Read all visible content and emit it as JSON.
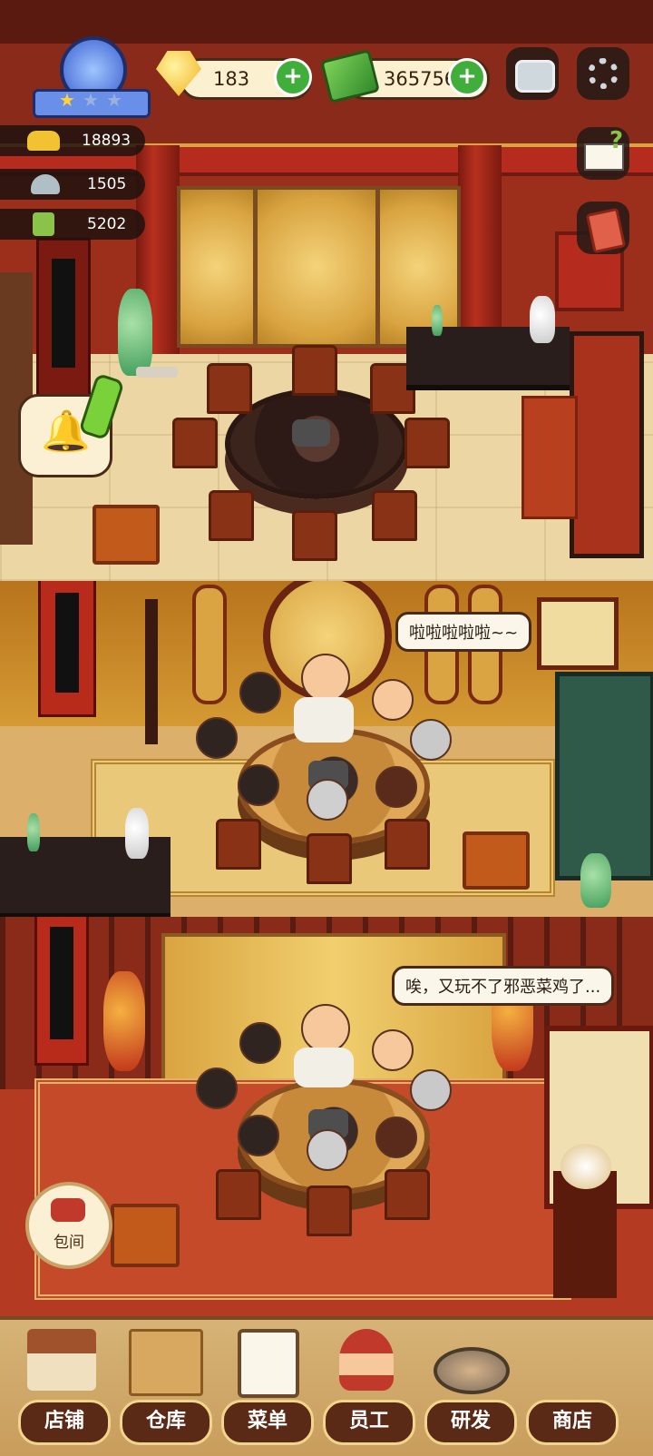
{
  "hud": {
    "gems": "183",
    "cash": "365756",
    "stat_gold_ingot": "18893",
    "stat_dish": "1505",
    "stat_ticket": "5202",
    "level_stars": 1
  },
  "bubbles": {
    "floor2": "啦啦啦啦啦~~",
    "floor3": "唉，又玩不了邪恶菜鸡了..."
  },
  "side_buttons": {
    "private_room": "包间"
  },
  "nav": [
    {
      "label": "店铺",
      "icon": "storefront-icon"
    },
    {
      "label": "仓库",
      "icon": "boxes-icon"
    },
    {
      "label": "菜单",
      "icon": "clipboard-icon"
    },
    {
      "label": "员工",
      "icon": "waitress-icon"
    },
    {
      "label": "研发",
      "icon": "wok-icon"
    },
    {
      "label": "商店",
      "icon": "shop-stall-icon"
    }
  ],
  "colors": {
    "accent_green": "#3fae3a",
    "nav_label_bg": "#5a2a16",
    "gold": "#d9a441",
    "wall_red": "#9c2f1c"
  }
}
